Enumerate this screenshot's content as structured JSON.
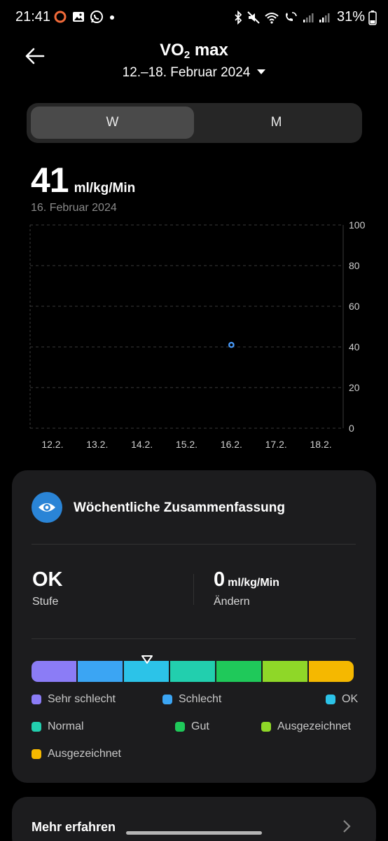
{
  "status_bar": {
    "time": "21:41",
    "battery": "31%"
  },
  "header": {
    "title_main": "VO",
    "title_sub": "2",
    "title_rest": " max",
    "date_range": "12.–18. Februar 2024"
  },
  "tabs": [
    {
      "label": "W",
      "selected": true
    },
    {
      "label": "M",
      "selected": false
    }
  ],
  "reading": {
    "value": "41",
    "unit": "ml/kg/Min",
    "date": "16. Februar 2024"
  },
  "chart_data": {
    "type": "scatter",
    "categories": [
      "12.2.",
      "13.2.",
      "14.2.",
      "15.2.",
      "16.2.",
      "17.2.",
      "18.2."
    ],
    "y_ticks": [
      "100",
      "80",
      "60",
      "40",
      "20",
      "0"
    ],
    "ylim": [
      0,
      100
    ],
    "points": [
      {
        "x": "16.2.",
        "y": 41
      }
    ],
    "point_color": "#4a9eff",
    "grid": true
  },
  "summary": {
    "title": "Wöchentliche Zusammenfassung",
    "level_value": "OK",
    "level_label": "Stufe",
    "change_value": "0",
    "change_unit": "ml/kg/Min",
    "change_label": "Ändern",
    "scale_colors": [
      "#8b7cf6",
      "#3ba5f3",
      "#2cc3e8",
      "#22cfae",
      "#1fc95a",
      "#8fd728",
      "#f5b800"
    ],
    "marker_segment": 2,
    "legend": [
      {
        "label": "Sehr schlecht",
        "color": "#8b7cf6"
      },
      {
        "label": "Schlecht",
        "color": "#3ba5f3"
      },
      {
        "label": "OK",
        "color": "#2cc3e8"
      },
      {
        "label": "Normal",
        "color": "#22cfae"
      },
      {
        "label": "Gut",
        "color": "#1fc95a"
      },
      {
        "label": "Ausgezeichnet",
        "color": "#8fd728"
      },
      {
        "label": "Ausgezeichnet",
        "color": "#f5b800"
      }
    ]
  },
  "more": {
    "title": "Mehr erfahren"
  }
}
